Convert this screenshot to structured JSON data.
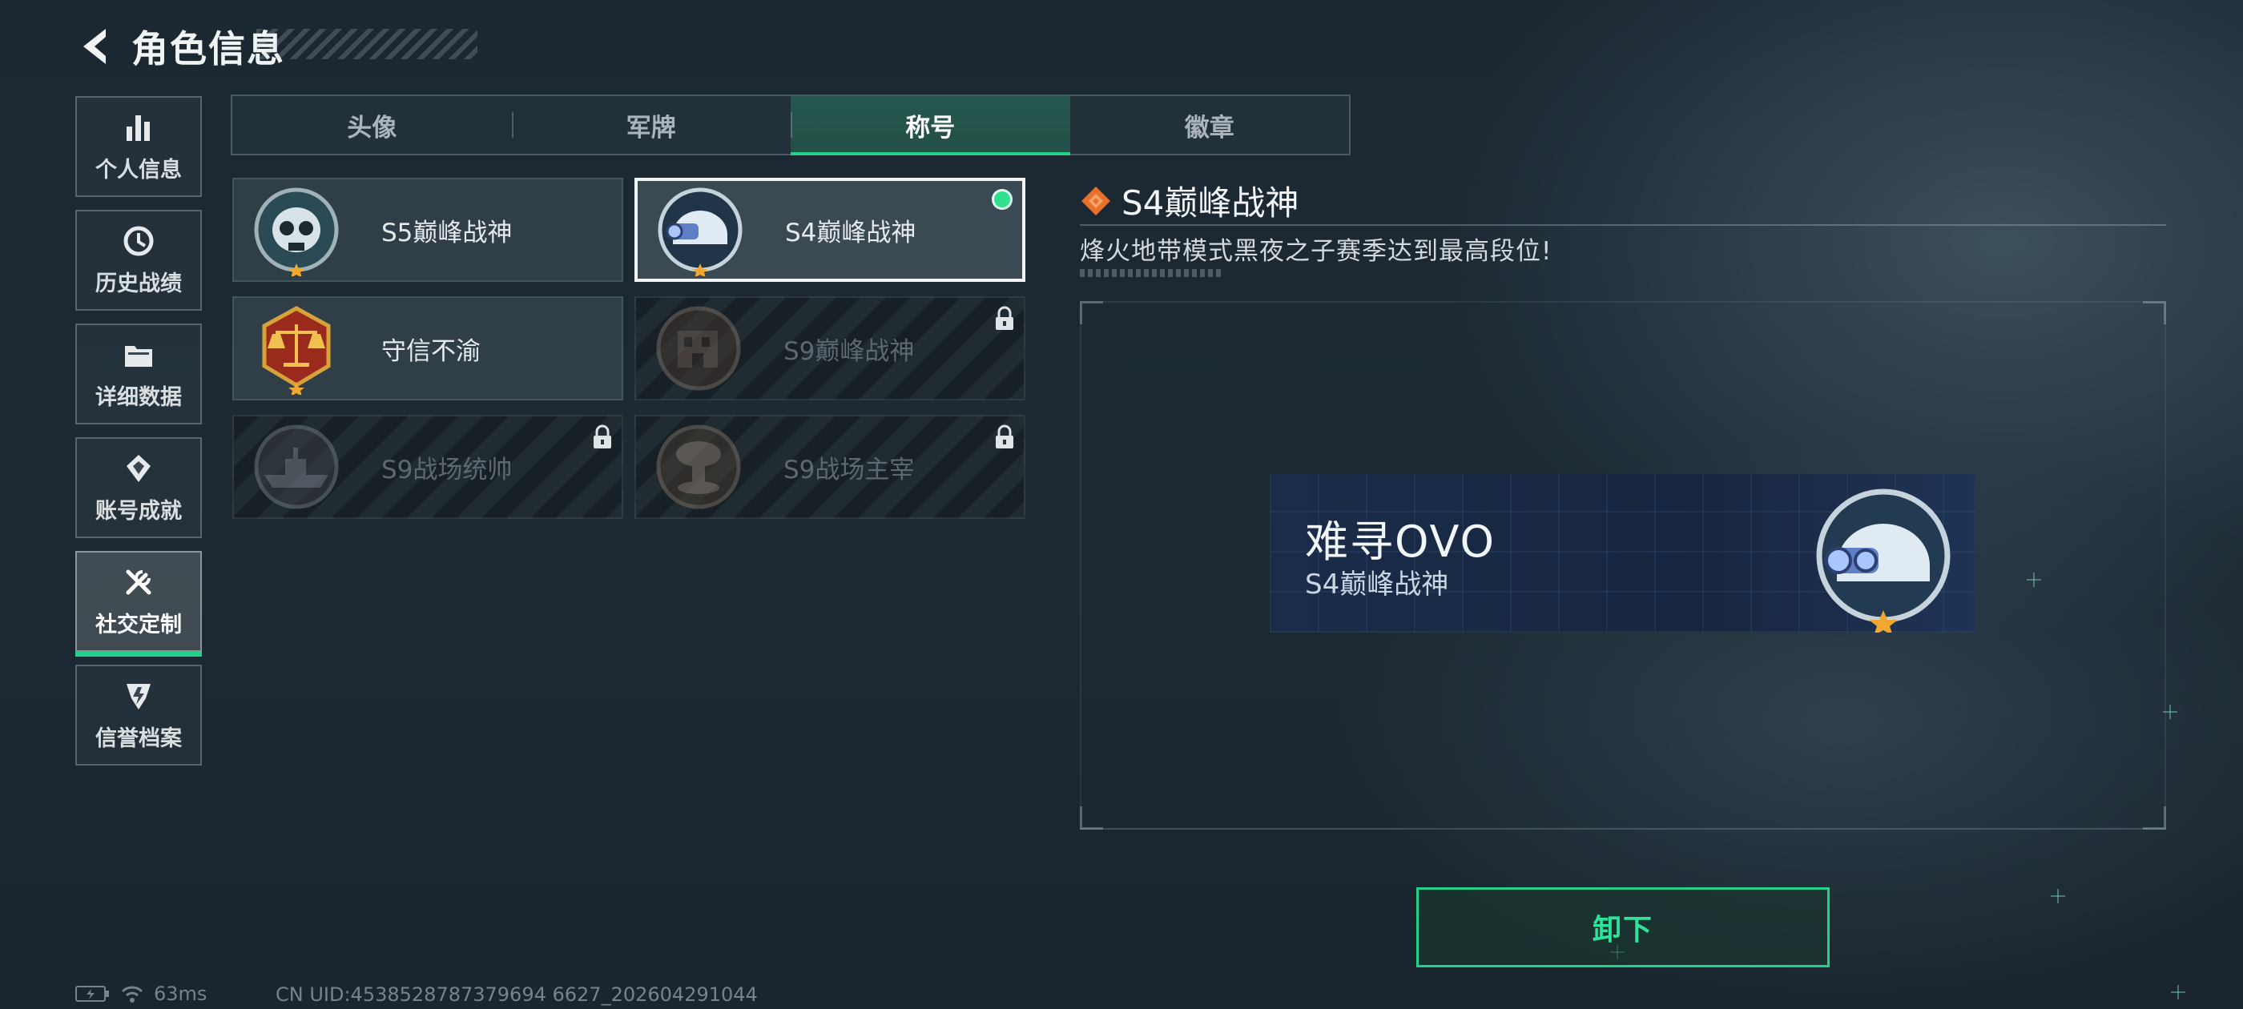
{
  "header": {
    "title": "角色信息"
  },
  "sidebar": {
    "items": [
      {
        "label": "个人信息",
        "icon": "bar-chart-icon",
        "active": false
      },
      {
        "label": "历史战绩",
        "icon": "history-icon",
        "active": false
      },
      {
        "label": "详细数据",
        "icon": "folder-icon",
        "active": false
      },
      {
        "label": "账号成就",
        "icon": "achievement-icon",
        "active": false
      },
      {
        "label": "社交定制",
        "icon": "tools-icon",
        "active": true
      },
      {
        "label": "信誉档案",
        "icon": "credit-shield-icon",
        "active": false
      }
    ]
  },
  "tabs": [
    {
      "label": "头像",
      "active": false
    },
    {
      "label": "军牌",
      "active": false
    },
    {
      "label": "称号",
      "active": true
    },
    {
      "label": "徽章",
      "active": false
    }
  ],
  "titles": [
    {
      "label": "S5巅峰战神",
      "icon": "skull-emblem-icon",
      "locked": false,
      "selected": false
    },
    {
      "label": "S4巅峰战神",
      "icon": "helmet-emblem-icon",
      "locked": false,
      "selected": true,
      "equipped": true
    },
    {
      "label": "守信不渝",
      "icon": "scales-emblem-icon",
      "locked": false,
      "selected": false
    },
    {
      "label": "S9巅峰战神",
      "icon": "building-emblem-icon",
      "locked": true,
      "selected": false
    },
    {
      "label": "S9战场统帅",
      "icon": "ship-emblem-icon",
      "locked": true,
      "selected": false
    },
    {
      "label": "S9战场主宰",
      "icon": "mushroom-cloud-emblem-icon",
      "locked": true,
      "selected": false
    }
  ],
  "detail": {
    "title": "S4巅峰战神",
    "description": "烽火地带模式黑夜之子赛季达到最高段位!"
  },
  "preview": {
    "player_name": "难寻OVO",
    "title": "S4巅峰战神"
  },
  "actions": {
    "unequip_label": "卸下"
  },
  "status": {
    "ping": "63ms",
    "uid": "CN UID:4538528787379694 6627_202604291044"
  },
  "colors": {
    "accent": "#23d18b",
    "banner": "#17263f",
    "highlight": "#e8702a"
  }
}
